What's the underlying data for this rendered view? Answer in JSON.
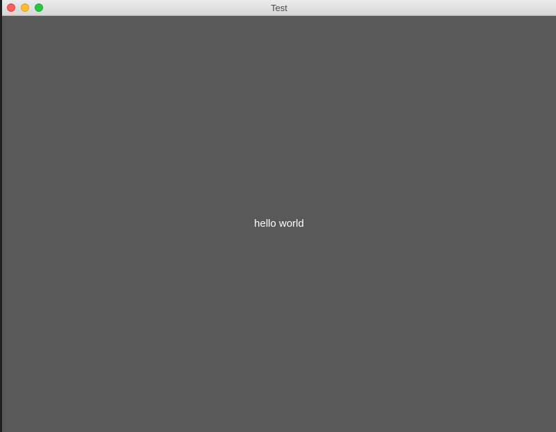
{
  "window": {
    "title": "Test",
    "controls": {
      "close_icon": "close-circle-icon",
      "minimize_icon": "minimize-circle-icon",
      "zoom_icon": "zoom-circle-icon",
      "close_color": "#fc5f57",
      "minimize_color": "#fdbc2e",
      "zoom_color": "#28c840"
    }
  },
  "content": {
    "message": "hello world",
    "background_color": "#595959",
    "text_color": "#ffffff"
  }
}
